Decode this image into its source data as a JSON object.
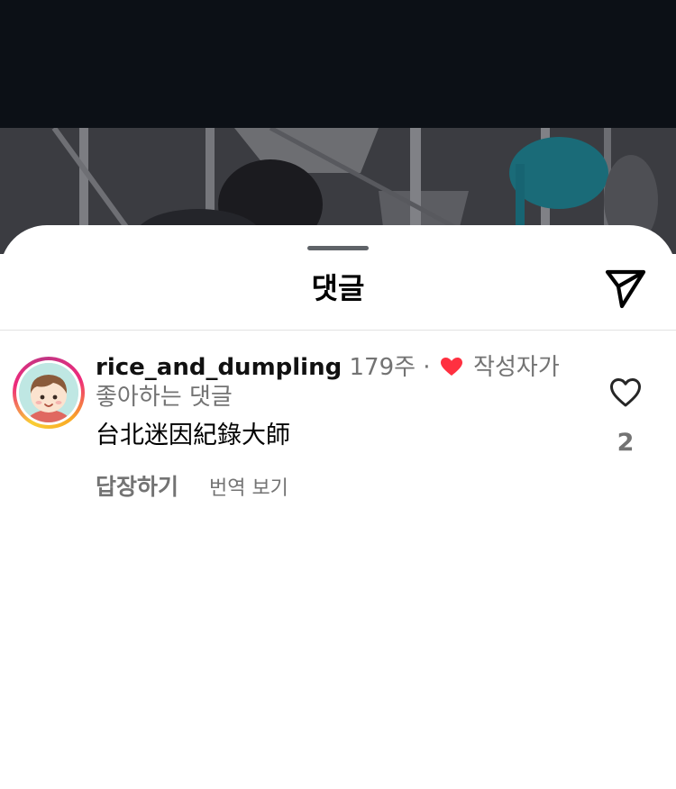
{
  "sheet": {
    "title": "댓글",
    "icons": {
      "share": "send-icon",
      "drag_handle": "grabber-bar"
    }
  },
  "comment": {
    "username": "rice_and_dumpling",
    "time": "179주",
    "separator": "·",
    "liked_by_creator_icon": "heart-icon",
    "liked_by_creator_text": "작성자가 좋아하는 댓글",
    "text": "台北迷因紀錄大師",
    "reply_label": "답장하기",
    "translate_label": "번역 보기",
    "like_count": "2",
    "like_icon": "heart-outline-icon"
  },
  "colors": {
    "accent_heart": "#ff3040",
    "top_bar": "#0c1016",
    "secondary_text": "#737373"
  }
}
